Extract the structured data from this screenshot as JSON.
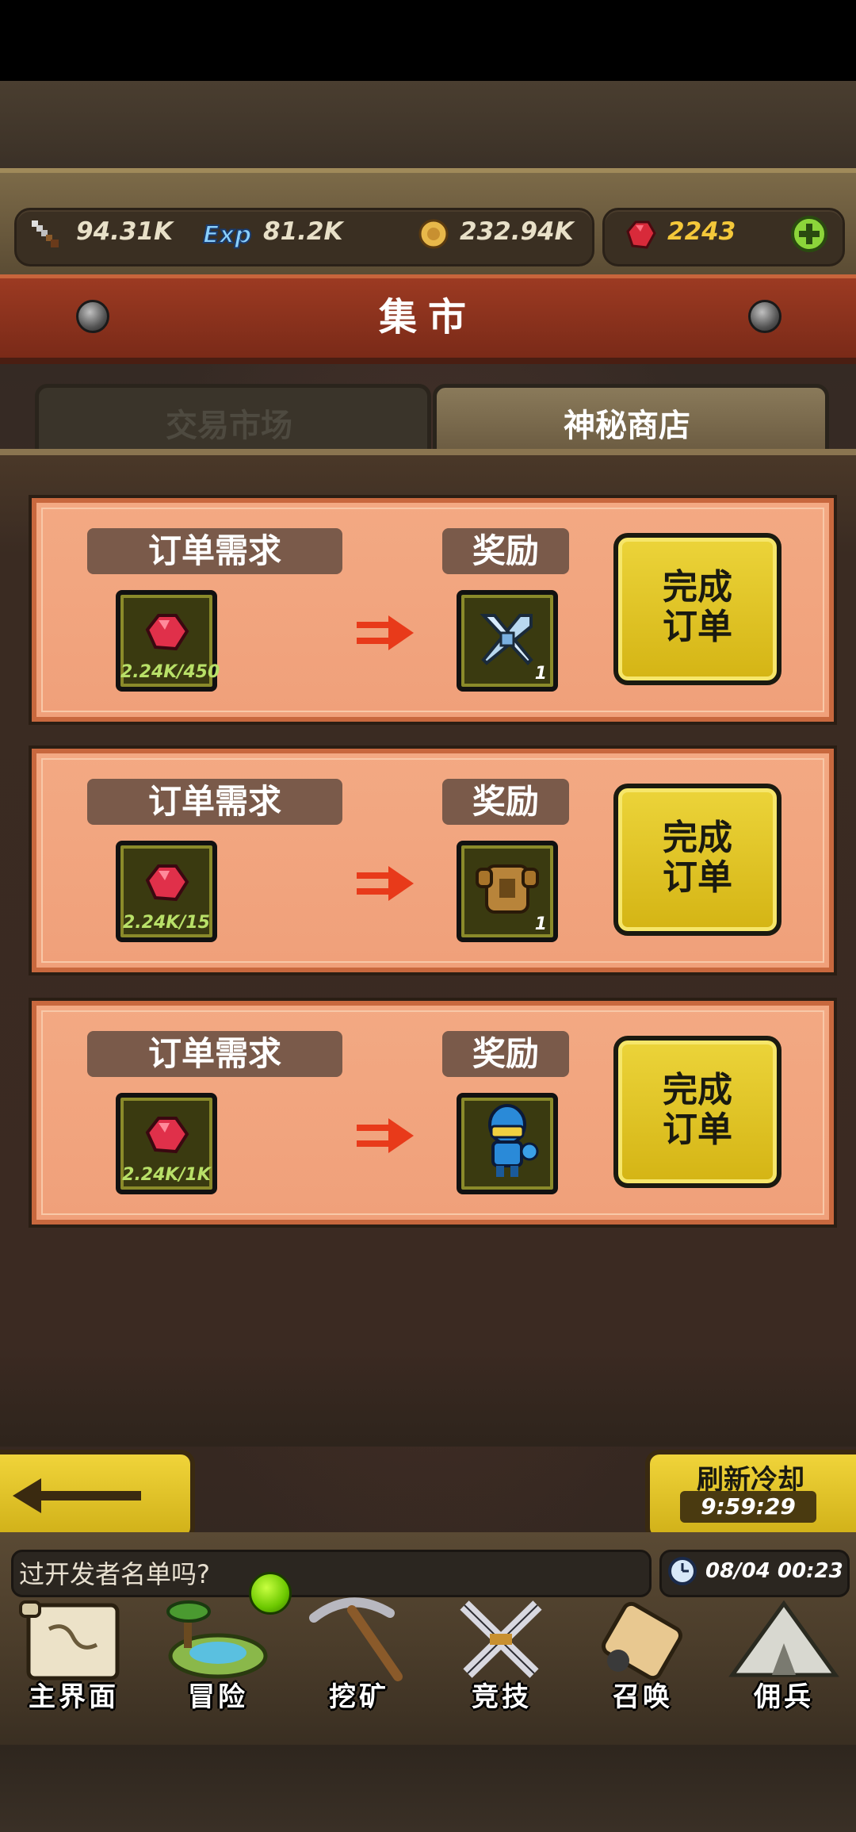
{
  "resources": {
    "attack": "94.31K",
    "exp": "81.2K",
    "gold": "232.94K",
    "gems": "2243"
  },
  "header": {
    "title": "集市"
  },
  "tabs": [
    {
      "label": "交易市场",
      "active": false
    },
    {
      "label": "神秘商店",
      "active": true
    }
  ],
  "orders": [
    {
      "demand_label": "订单需求",
      "reward_label": "奖励",
      "demand_progress": "2.24K/450",
      "reward_count": "1",
      "reward_icon": "sword-icon",
      "button": "完成\n订单"
    },
    {
      "demand_label": "订单需求",
      "reward_label": "奖励",
      "demand_progress": "2.24K/15",
      "reward_count": "1",
      "reward_icon": "armor-icon",
      "button": "完成\n订单"
    },
    {
      "demand_label": "订单需求",
      "reward_label": "奖励",
      "demand_progress": "2.24K/1K",
      "reward_count": "",
      "reward_icon": "hero-icon",
      "button": "完成\n订单"
    }
  ],
  "refresh": {
    "title": "刷新冷却",
    "timer": "9:59:29"
  },
  "chat": {
    "text": "过开发者名单吗?"
  },
  "clock": {
    "text": "08/04 00:23"
  },
  "nav": [
    {
      "label": "主界面",
      "icon": "scroll-map-icon"
    },
    {
      "label": "冒险",
      "icon": "island-icon"
    },
    {
      "label": "挖矿",
      "icon": "pickaxe-icon"
    },
    {
      "label": "竞技",
      "icon": "crossed-swords-icon"
    },
    {
      "label": "召唤",
      "icon": "summon-scroll-icon"
    },
    {
      "label": "佣兵",
      "icon": "tent-icon"
    }
  ]
}
